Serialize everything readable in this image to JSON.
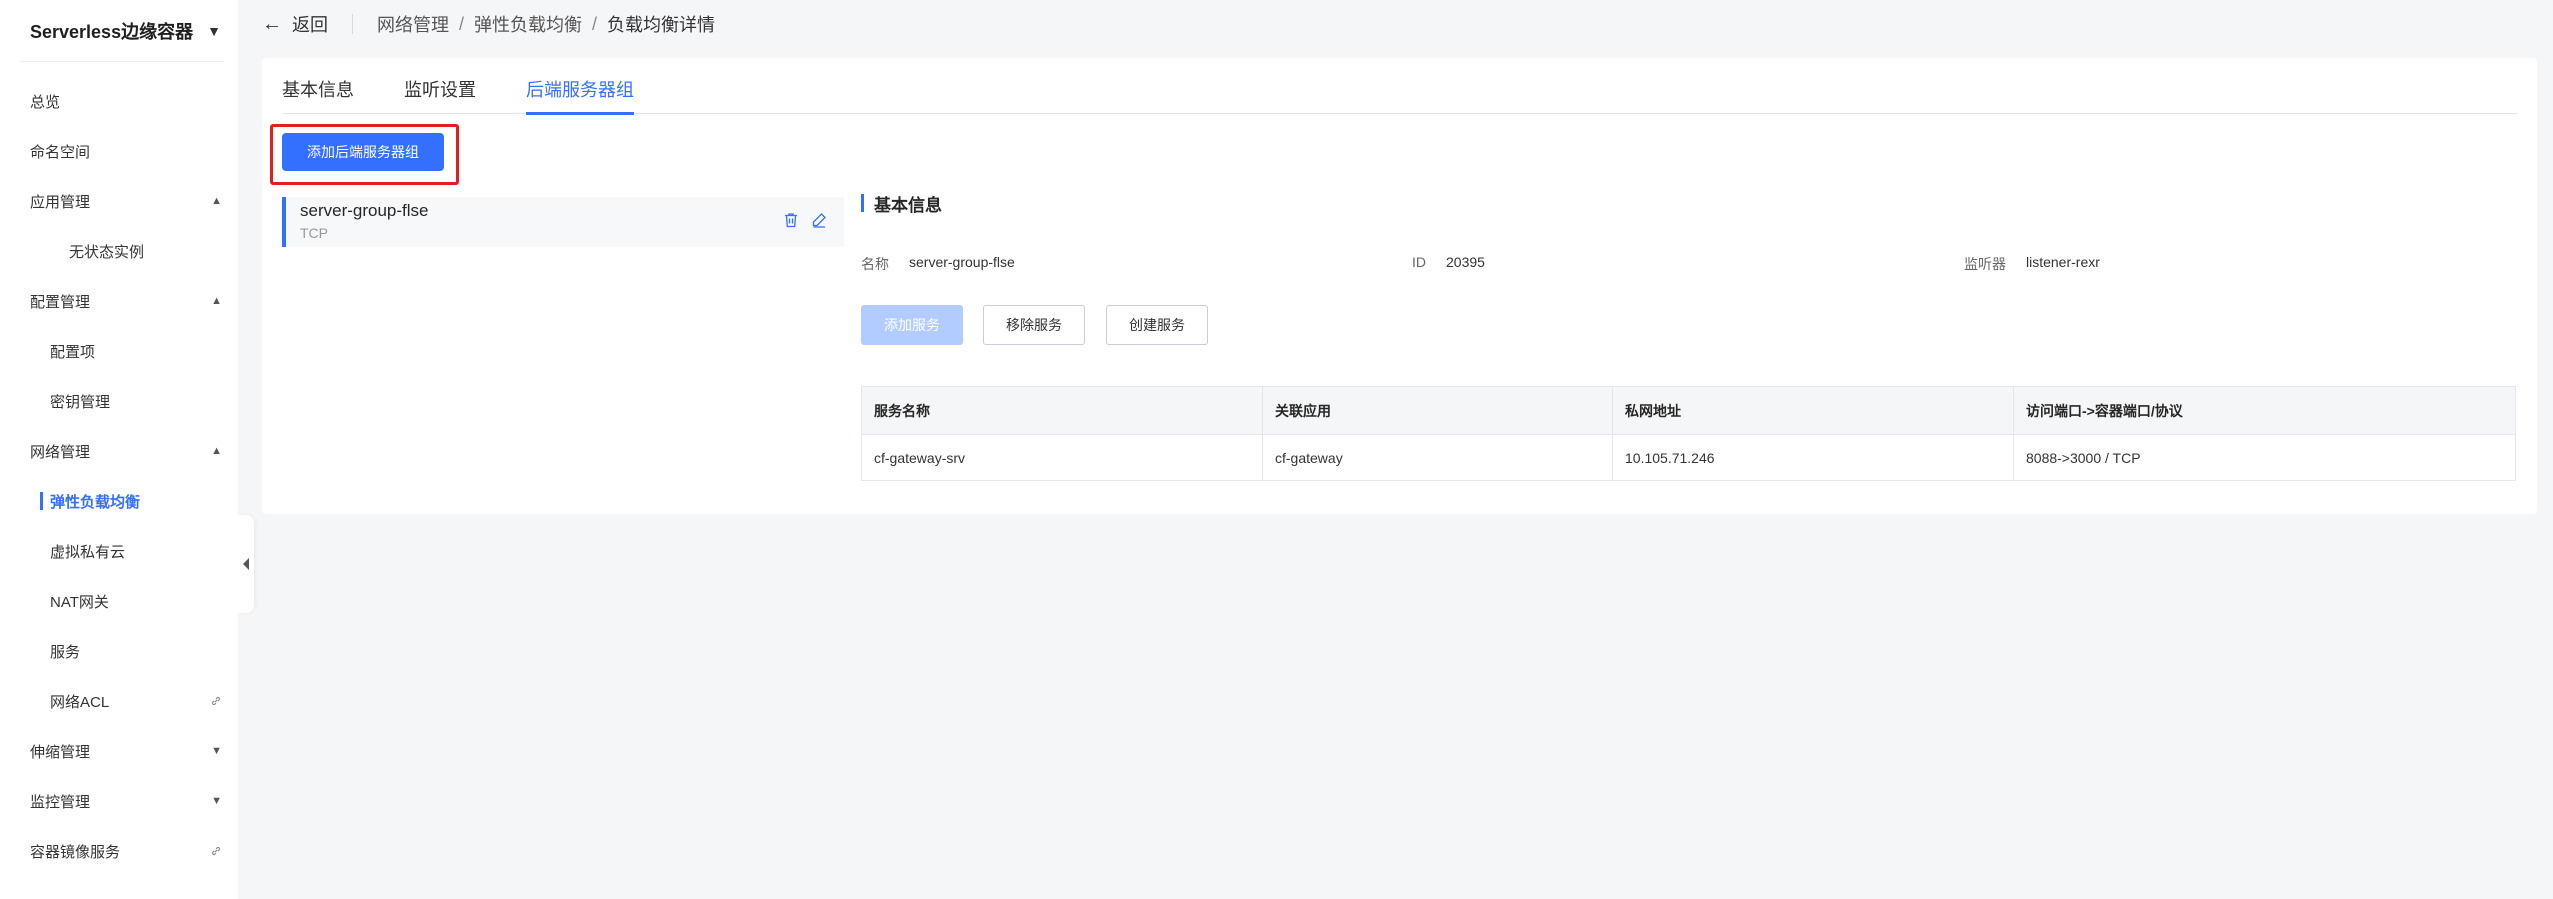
{
  "sidebar": {
    "product_title": "Serverless边缘容器",
    "items": [
      {
        "label": "总览"
      },
      {
        "label": "命名空间"
      },
      {
        "label": "应用管理"
      },
      {
        "label": "无状态实例"
      },
      {
        "label": "配置管理"
      },
      {
        "label": "配置项"
      },
      {
        "label": "密钥管理"
      },
      {
        "label": "网络管理"
      },
      {
        "label": "弹性负载均衡"
      },
      {
        "label": "虚拟私有云"
      },
      {
        "label": "NAT网关"
      },
      {
        "label": "服务"
      },
      {
        "label": "网络ACL"
      },
      {
        "label": "伸缩管理"
      },
      {
        "label": "监控管理"
      },
      {
        "label": "容器镜像服务"
      }
    ]
  },
  "topbar": {
    "back_label": "返回",
    "breadcrumbs": [
      "网络管理",
      "弹性负载均衡",
      "负载均衡详情"
    ]
  },
  "tabs": [
    "基本信息",
    "监听设置",
    "后端服务器组"
  ],
  "add_group_button": "添加后端服务器组",
  "server_group": {
    "name": "server-group-flse",
    "protocol": "TCP"
  },
  "basic_info": {
    "title": "基本信息",
    "name_label": "名称",
    "name_value": "server-group-flse",
    "id_label": "ID",
    "id_value": "20395",
    "listener_label": "监听器",
    "listener_value": "listener-rexr"
  },
  "actions": {
    "add_service": "添加服务",
    "remove_service": "移除服务",
    "create_service": "创建服务"
  },
  "table": {
    "headers": [
      "服务名称",
      "关联应用",
      "私网地址",
      "访问端口->容器端口/协议"
    ],
    "rows": [
      [
        "cf-gateway-srv",
        "cf-gateway",
        "10.105.71.246",
        "8088->3000 / TCP"
      ]
    ]
  },
  "colors": {
    "accent": "#3370ff",
    "highlight_border": "#e02020",
    "disabled_button": "#b3ccff"
  }
}
